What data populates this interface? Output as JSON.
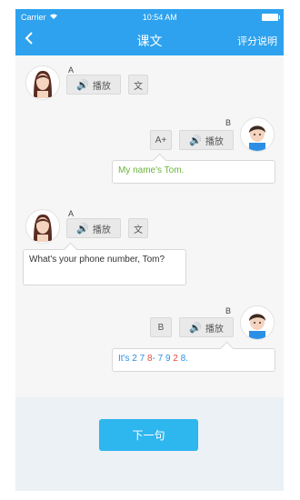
{
  "status": {
    "carrier": "Carrier",
    "wifi_icon": "wifi-icon",
    "time": "10:54 AM",
    "battery_icon": "battery-icon"
  },
  "nav": {
    "back_icon": "chevron-left-icon",
    "title": "课文",
    "right_label": "评分说明"
  },
  "messages": [
    {
      "speaker": "A",
      "play_label": "播放",
      "translate_label": "文",
      "text": ""
    },
    {
      "speaker": "B",
      "grade": "A+",
      "play_label": "播放",
      "text": "My name's Tom."
    },
    {
      "speaker": "A",
      "play_label": "播放",
      "translate_label": "文",
      "text": "What's your phone number, Tom?"
    },
    {
      "speaker": "B",
      "grade": "B",
      "play_label": "播放",
      "text_parts": [
        "It's ",
        "2",
        " ",
        "7",
        " ",
        "8",
        "- ",
        "7",
        " ",
        "9",
        " ",
        "2",
        " ",
        "8",
        "."
      ]
    }
  ],
  "footer": {
    "next_label": "下一句"
  },
  "colors": {
    "accent": "#2ea2ee",
    "correct": "#6ab33c",
    "wrong": "#e74c3c",
    "button": "#2eb6ef"
  }
}
